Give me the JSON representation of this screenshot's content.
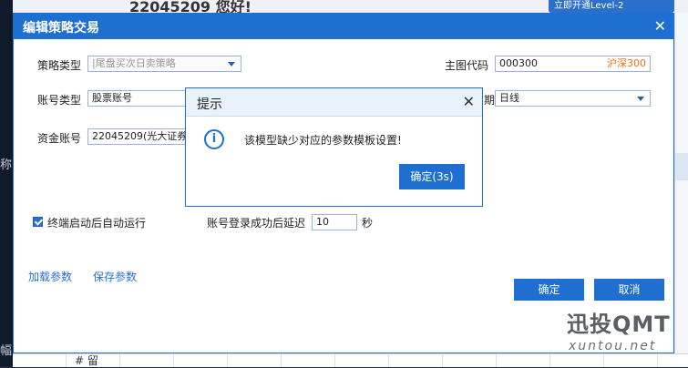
{
  "background": {
    "greeting": "22045209 您好!",
    "level2_badge": "立即开通Level-2",
    "left_glyphs": [
      "称",
      "幅"
    ],
    "bottom_text": "# 留"
  },
  "dialog": {
    "title": "编辑策略交易",
    "close_symbol": "✕",
    "strategy_type": {
      "label": "策略类型",
      "value": "|尾盘买次日卖策略"
    },
    "main_code": {
      "label": "主图代码",
      "value": "000300",
      "tag": "沪深300"
    },
    "account_type": {
      "label": "账号类型",
      "value": "股票账号"
    },
    "period": {
      "label": "期",
      "value": "日线"
    },
    "fund_account": {
      "label": "资金账号",
      "value": "22045209(光大证券)"
    },
    "autorun": {
      "label": "终端启动后自动运行",
      "checked": true
    },
    "delay": {
      "label": "账号登录成功后延迟",
      "value": "10",
      "unit": "秒"
    },
    "load_params": "加载参数",
    "save_params": "保存参数",
    "confirm": "确定",
    "cancel": "取消"
  },
  "popup": {
    "title": "提示",
    "close_symbol": "✕",
    "icon": "info-icon",
    "message": "该模型缺少对应的参数模板设置!",
    "ok_button": "确定(3s)"
  },
  "watermark": {
    "brand": "迅投QMT",
    "domain": "xuntou.net"
  },
  "colors": {
    "accent": "#1f6fd0",
    "tag": "#e8731a"
  }
}
